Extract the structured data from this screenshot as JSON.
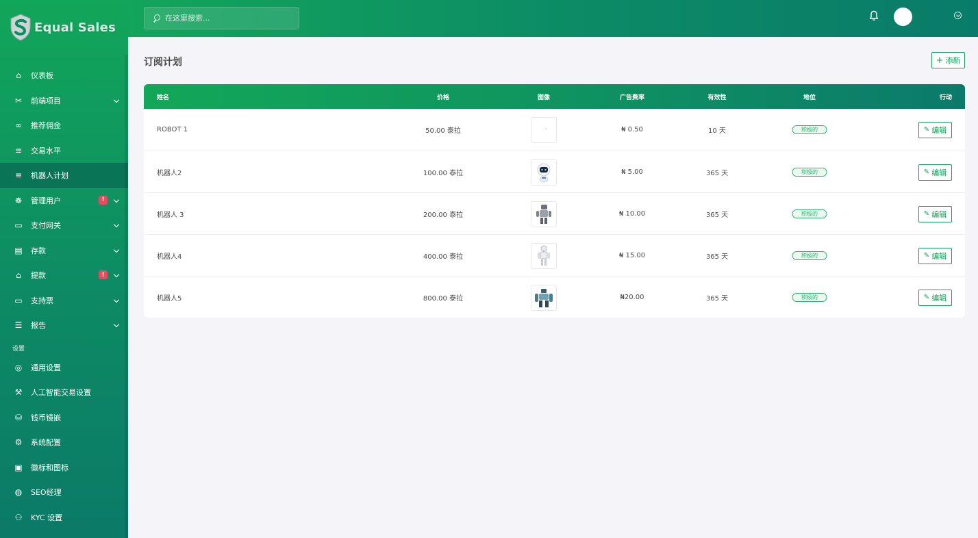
{
  "brand": {
    "name": "Equal Sales"
  },
  "sidebar": {
    "items": [
      {
        "label": "仪表板",
        "icon": "home-icon",
        "glyph": "⌂",
        "chevron": false,
        "alert": ""
      },
      {
        "label": "前端项目",
        "icon": "tools-icon",
        "glyph": "✂",
        "chevron": true,
        "alert": ""
      },
      {
        "label": "推荐佣金",
        "icon": "link-icon",
        "glyph": "∞",
        "chevron": false,
        "alert": ""
      },
      {
        "label": "交易水平",
        "icon": "list-icon",
        "glyph": "≡",
        "chevron": false,
        "alert": ""
      },
      {
        "label": "机器人计划",
        "icon": "list-icon",
        "glyph": "≡",
        "chevron": false,
        "alert": "",
        "active": true
      },
      {
        "label": "管理用户",
        "icon": "users-icon",
        "glyph": "☸",
        "chevron": true,
        "alert": "!"
      },
      {
        "label": "支付网关",
        "icon": "credit-card-icon",
        "glyph": "▭",
        "chevron": true,
        "alert": ""
      },
      {
        "label": "存款",
        "icon": "deposit-icon",
        "glyph": "▤",
        "chevron": true,
        "alert": ""
      },
      {
        "label": "提款",
        "icon": "bank-icon",
        "glyph": "⌂",
        "chevron": true,
        "alert": "!"
      },
      {
        "label": "支持票",
        "icon": "ticket-icon",
        "glyph": "▭",
        "chevron": true,
        "alert": ""
      },
      {
        "label": "报告",
        "icon": "report-list-icon",
        "glyph": "☰",
        "chevron": true,
        "alert": ""
      }
    ],
    "settings_label": "设置",
    "settings_items": [
      {
        "label": "通用设置",
        "icon": "life-ring-icon",
        "glyph": "◎"
      },
      {
        "label": "人工智能交易设置",
        "icon": "hammer-icon",
        "glyph": "⚒"
      },
      {
        "label": "钱币镜嵌",
        "icon": "coins-icon",
        "glyph": "⛁"
      },
      {
        "label": "系统配置",
        "icon": "gear-icon",
        "glyph": "⚙"
      },
      {
        "label": "徽标和图标",
        "icon": "images-icon",
        "glyph": "▣"
      },
      {
        "label": "SEO经理",
        "icon": "globe-icon",
        "glyph": "◍"
      },
      {
        "label": "KYC 设置",
        "icon": "user-settings-icon",
        "glyph": "⚇"
      }
    ]
  },
  "topbar": {
    "search_placeholder": "在这里搜索..."
  },
  "main": {
    "title": "订阅计划",
    "add_label": "添新",
    "columns": [
      "姓名",
      "价格",
      "图像",
      "广告费率",
      "有效性",
      "地位",
      "行动"
    ],
    "rows": [
      {
        "name": "ROBOT 1",
        "price": "50.00 泰拉",
        "image": "blank",
        "rate": "₦ 0.50",
        "validity": "10 天",
        "status": "积极的",
        "action": "编辑"
      },
      {
        "name": "机器人2",
        "price": "100.00 泰拉",
        "image": "robot-round",
        "rate": "₦ 5.00",
        "validity": "365 天",
        "status": "积极的",
        "action": "编辑"
      },
      {
        "name": "机器人 3",
        "price": "200.00 泰拉",
        "image": "robot-grey",
        "rate": "₦ 10.00",
        "validity": "365 天",
        "status": "积极的",
        "action": "编辑"
      },
      {
        "name": "机器人4",
        "price": "400.00 泰拉",
        "image": "robot-white",
        "rate": "₦ 15.00",
        "validity": "365 天",
        "status": "积极的",
        "action": "编辑"
      },
      {
        "name": "机器人5",
        "price": "800.00 泰拉",
        "image": "robot-mech",
        "rate": "₦20.00",
        "validity": "365 天",
        "status": "积极的",
        "action": "编辑"
      }
    ]
  }
}
